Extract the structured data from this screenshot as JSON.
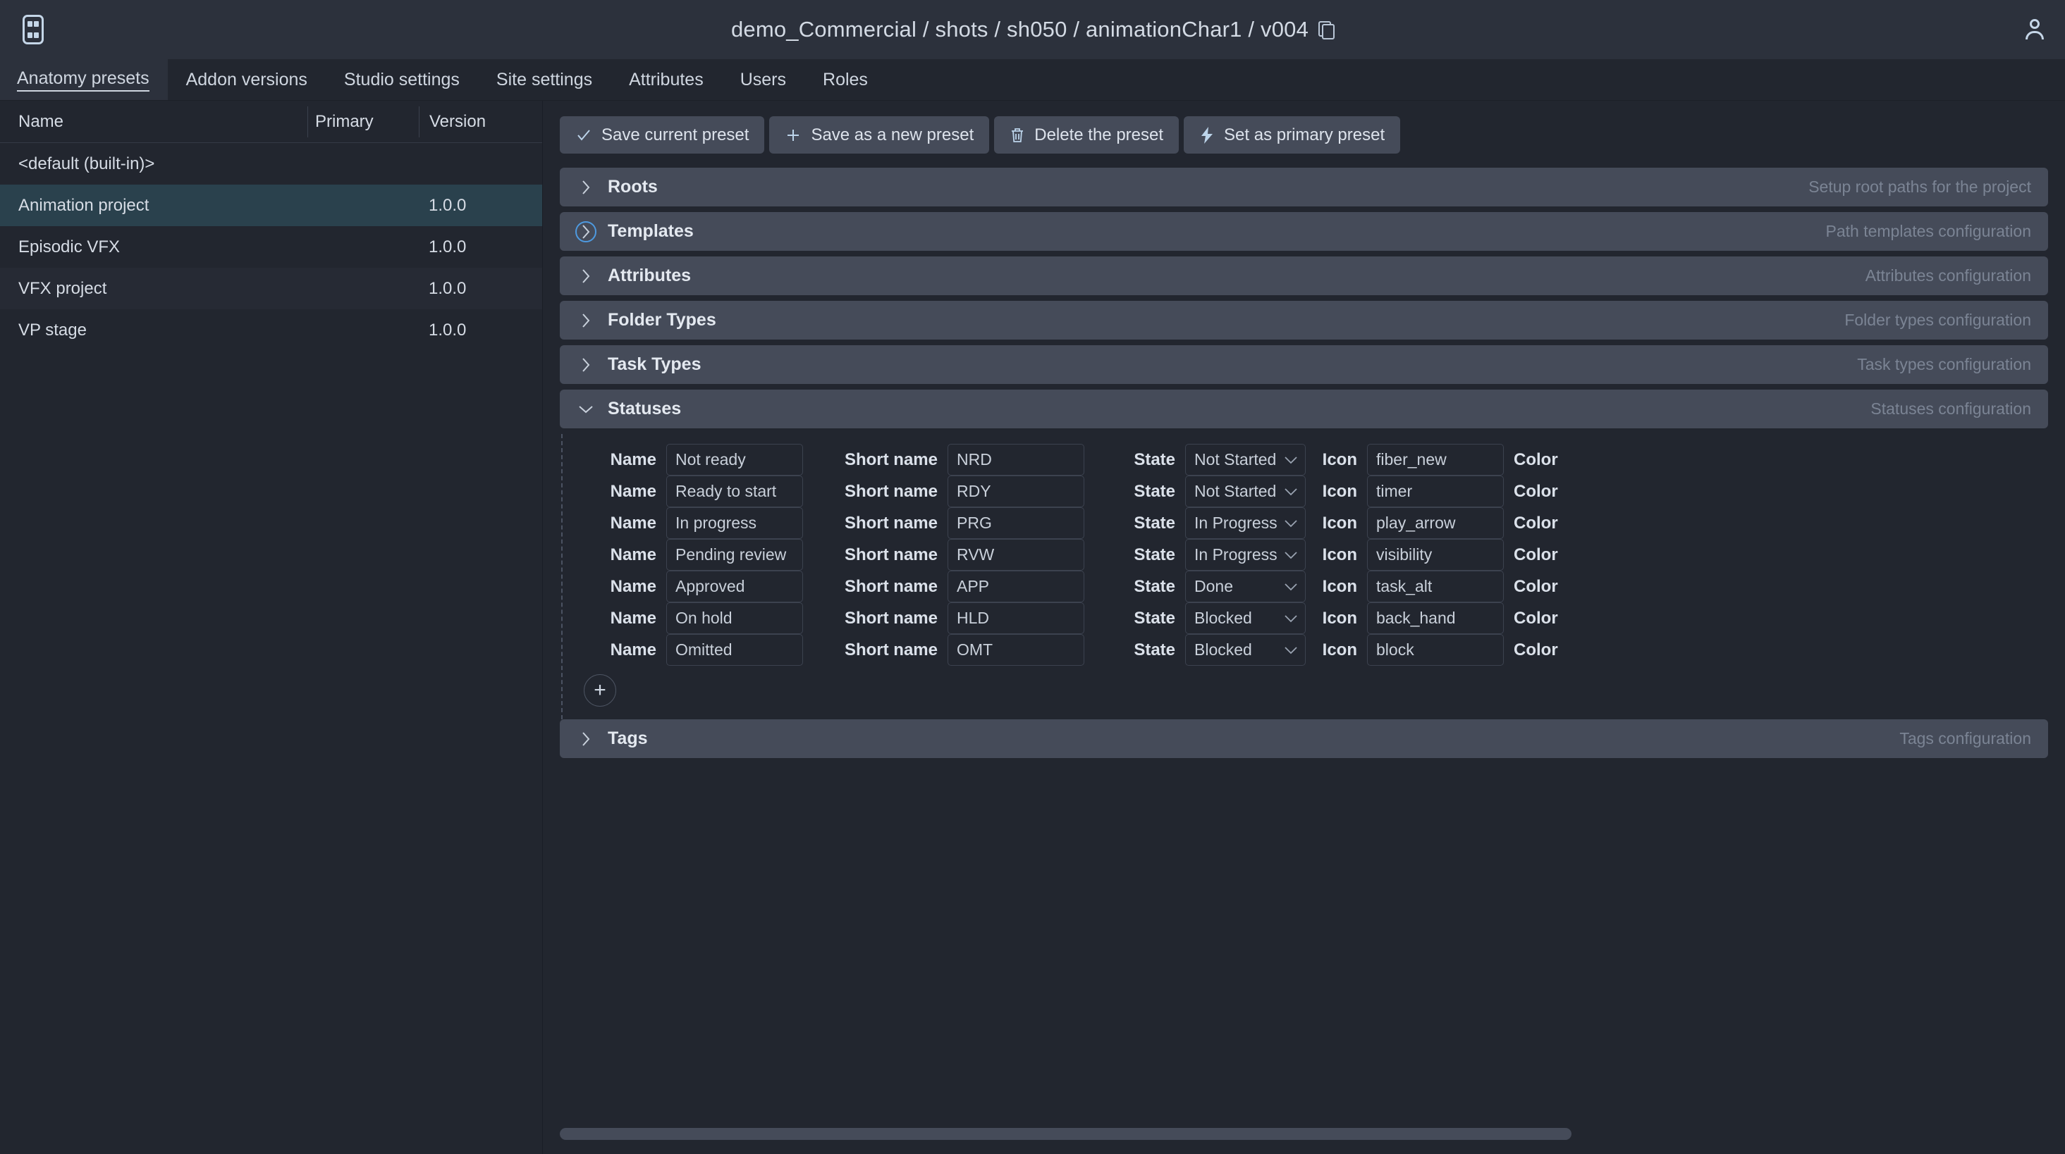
{
  "header": {
    "logo_name": "ayon-logo",
    "title": "demo_Commercial / shots / sh050 / animationChar1 / v004",
    "copy_icon": "copy-icon",
    "user_icon": "user-avatar-icon"
  },
  "tabs": [
    {
      "label": "Anatomy presets",
      "active": true
    },
    {
      "label": "Addon versions",
      "active": false
    },
    {
      "label": "Studio settings",
      "active": false
    },
    {
      "label": "Site settings",
      "active": false
    },
    {
      "label": "Attributes",
      "active": false
    },
    {
      "label": "Users",
      "active": false
    },
    {
      "label": "Roles",
      "active": false
    }
  ],
  "presets": {
    "columns": [
      "Name",
      "Primary",
      "Version"
    ],
    "rows": [
      {
        "name": "<default (built-in)>",
        "primary": "",
        "version": "",
        "selected": false
      },
      {
        "name": "Animation project",
        "primary": "",
        "version": "1.0.0",
        "selected": true
      },
      {
        "name": "Episodic VFX",
        "primary": "",
        "version": "1.0.0",
        "selected": false
      },
      {
        "name": "VFX project",
        "primary": "",
        "version": "1.0.0",
        "selected": false
      },
      {
        "name": "VP stage",
        "primary": "",
        "version": "1.0.0",
        "selected": false
      }
    ]
  },
  "toolbar": [
    {
      "label": "Save current preset",
      "icon": "check-icon"
    },
    {
      "label": "Save as a new preset",
      "icon": "plus-icon"
    },
    {
      "label": "Delete the preset",
      "icon": "trash-icon"
    },
    {
      "label": "Set as primary preset",
      "icon": "bolt-icon"
    }
  ],
  "sections": [
    {
      "title": "Roots",
      "subtitle": "Setup root paths for the project",
      "expanded": false,
      "focused": false
    },
    {
      "title": "Templates",
      "subtitle": "Path templates configuration",
      "expanded": false,
      "focused": true
    },
    {
      "title": "Attributes",
      "subtitle": "Attributes configuration",
      "expanded": false,
      "focused": false
    },
    {
      "title": "Folder Types",
      "subtitle": "Folder types configuration",
      "expanded": false,
      "focused": false
    },
    {
      "title": "Task Types",
      "subtitle": "Task types configuration",
      "expanded": false,
      "focused": false
    },
    {
      "title": "Statuses",
      "subtitle": "Statuses configuration",
      "expanded": true,
      "focused": false
    },
    {
      "title": "Tags",
      "subtitle": "Tags configuration",
      "expanded": false,
      "focused": false
    }
  ],
  "statuses": {
    "labels": {
      "name": "Name",
      "short_name": "Short name",
      "state": "State",
      "icon": "Icon",
      "color": "Color"
    },
    "add_button": "+",
    "rows": [
      {
        "name": "Not ready",
        "short_name": "NRD",
        "state": "Not Started",
        "icon": "fiber_new"
      },
      {
        "name": "Ready to start",
        "short_name": "RDY",
        "state": "Not Started",
        "icon": "timer"
      },
      {
        "name": "In progress",
        "short_name": "PRG",
        "state": "In Progress",
        "icon": "play_arrow"
      },
      {
        "name": "Pending review",
        "short_name": "RVW",
        "state": "In Progress",
        "icon": "visibility"
      },
      {
        "name": "Approved",
        "short_name": "APP",
        "state": "Done",
        "icon": "task_alt"
      },
      {
        "name": "On hold",
        "short_name": "HLD",
        "state": "Blocked",
        "icon": "back_hand"
      },
      {
        "name": "Omitted",
        "short_name": "OMT",
        "state": "Blocked",
        "icon": "block"
      }
    ]
  },
  "colors": {
    "app_bg": "#22262f",
    "header_bg": "#2c313c",
    "section_bg": "#454b59",
    "selected_row": "#2a414d",
    "input_bg": "#22262f",
    "accent": "#4e9ae0",
    "text": "#d6dce5",
    "muted": "#7b8494"
  }
}
